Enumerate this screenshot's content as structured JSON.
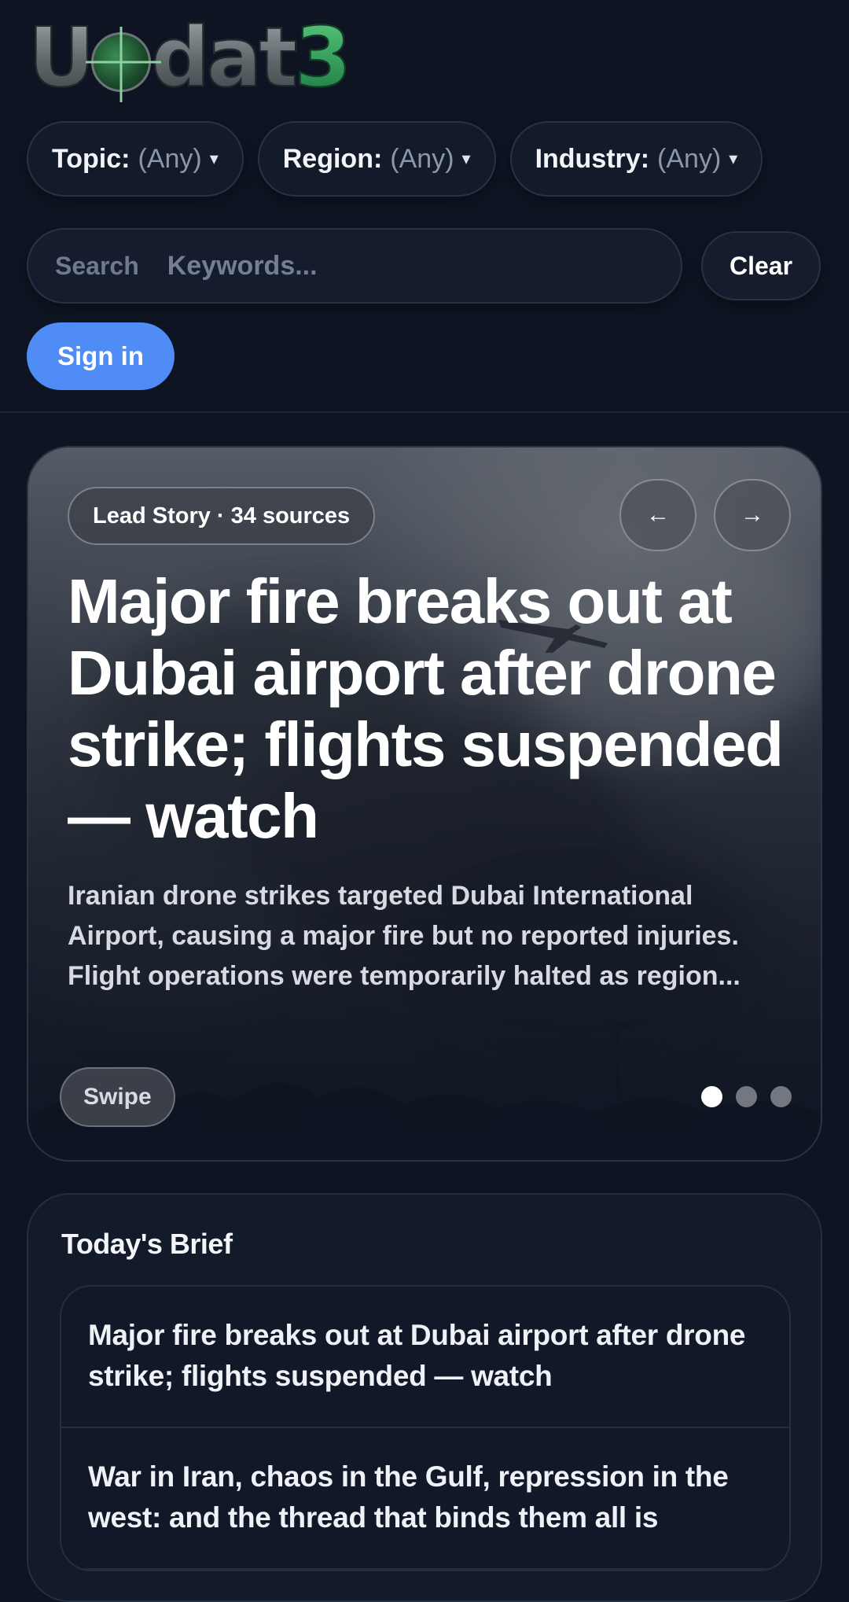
{
  "logo": {
    "text": "Updat",
    "accent": "3"
  },
  "filters": [
    {
      "label": "Topic:",
      "value": "(Any)",
      "caret": "▾"
    },
    {
      "label": "Region:",
      "value": "(Any)",
      "caret": "▾"
    },
    {
      "label": "Industry:",
      "value": "(Any)",
      "caret": "▾"
    }
  ],
  "search": {
    "label": "Search",
    "placeholder": "Keywords..."
  },
  "clear_label": "Clear",
  "signin_label": "Sign in",
  "hero": {
    "badge": "Lead Story · 34 sources",
    "prev_arrow": "←",
    "next_arrow": "→",
    "title": "Major fire breaks out at Dubai airport after drone strike; flights suspended — watch",
    "summary": "Iranian drone strikes targeted Dubai International Airport, causing a major fire but no reported injuries. Flight operations were temporarily halted as region...",
    "swipe_label": "Swipe",
    "dots": {
      "count": 3,
      "active": 0
    }
  },
  "brief": {
    "title": "Today's Brief",
    "items": [
      "Major fire breaks out at Dubai airport after drone strike; flights suspended — watch",
      "War in Iran, chaos in the Gulf, repression in the west: and the thread that binds them all is"
    ]
  },
  "colors": {
    "background": "#0e1422",
    "accent_blue": "#4f8cf5",
    "muted_text": "#8d97ab"
  }
}
